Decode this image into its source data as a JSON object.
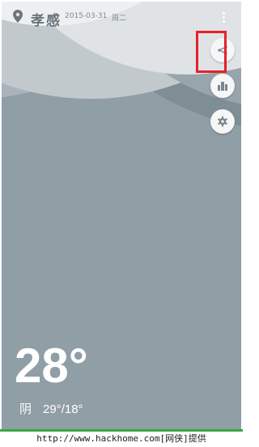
{
  "header": {
    "city": "孝感",
    "date": "2015-03-31",
    "weekday": "周二",
    "location_icon": "map-pin-icon",
    "menu_icon": "more-vertical-icon"
  },
  "actions": [
    {
      "name": "share",
      "icon": "share-icon",
      "highlighted": true
    },
    {
      "name": "cities",
      "icon": "city-buildings-icon",
      "highlighted": false
    },
    {
      "name": "settings",
      "icon": "gear-icon",
      "highlighted": false
    }
  ],
  "weather": {
    "current_temp": "28°",
    "condition": "阴",
    "range": "29°/18°"
  },
  "watermark": "http://www.hackhome.com[网侠]提供",
  "colors": {
    "background": "#909ea6",
    "highlight": "#e8202a",
    "watermark_bar": "#3aa845"
  }
}
